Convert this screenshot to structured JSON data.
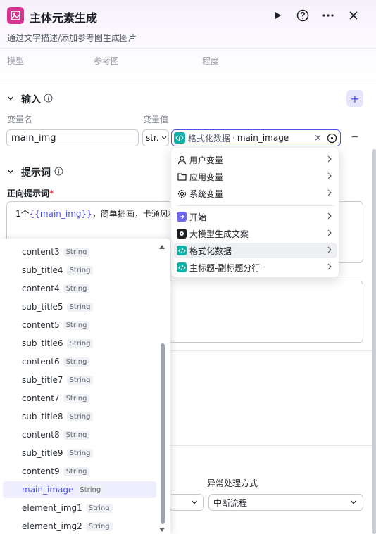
{
  "header": {
    "title": "主体元素生成",
    "description": "通过文字描述/添加参考图生成图片",
    "node_icon_color": "#d4338f"
  },
  "columns": {
    "model": "模型",
    "reference": "参考图",
    "degree": "程度"
  },
  "input_section": {
    "title": "输入",
    "col_name": "变量名",
    "col_value": "变量值",
    "var_name": "main_img",
    "type_value": "str.",
    "value_source": "格式化数据",
    "value_sep": "·",
    "value_var": "main_image",
    "clear_symbol": "×",
    "remove_symbol": "−"
  },
  "prompt_section": {
    "title": "提示词",
    "positive_label": "正向提示词",
    "required_mark": "*",
    "prompt_prefix": "1个",
    "prompt_var": "{{main_img}}",
    "prompt_rest": "，简单插画，卡通风格，"
  },
  "error_section": {
    "label": "异常处理方式",
    "value": "中断流程"
  },
  "popover": {
    "groups": [
      {
        "label": "用户变量",
        "icon": "user-icon"
      },
      {
        "label": "应用变量",
        "icon": "folder-icon"
      },
      {
        "label": "系统变量",
        "icon": "settings-icon"
      }
    ],
    "nodes": [
      {
        "label": "开始",
        "icon": "start-node-icon"
      },
      {
        "label": "大模型生成文案",
        "icon": "llm-node-icon"
      },
      {
        "label": "格式化数据",
        "icon": "code-node-icon"
      },
      {
        "label": "主标题-副标题分行",
        "icon": "code-node-icon"
      }
    ]
  },
  "variable_list": {
    "type_badge": "String",
    "items": [
      "content3",
      "sub_title4",
      "content4",
      "sub_title5",
      "content5",
      "sub_title6",
      "content6",
      "sub_title7",
      "content7",
      "sub_title8",
      "content8",
      "sub_title9",
      "content9",
      "main_image",
      "element_img1",
      "element_img2"
    ],
    "selected": "main_image"
  },
  "colors": {
    "accent": "#4d53e8",
    "code_node": "#0fb1a6",
    "start_node": "#6f67f0",
    "llm_node": "#1c1f23"
  }
}
